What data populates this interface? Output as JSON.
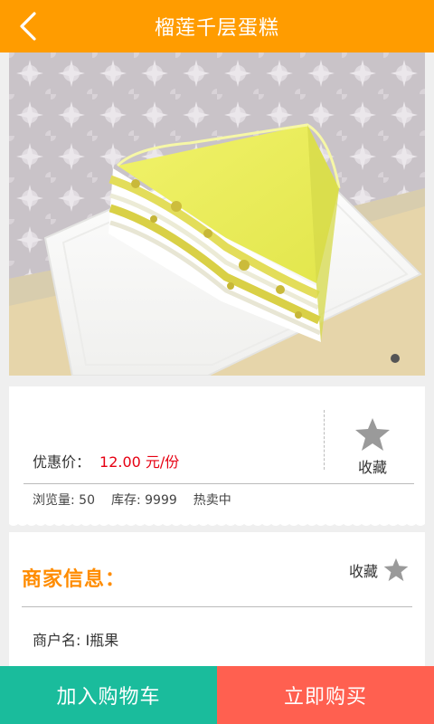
{
  "header": {
    "title": "榴莲千层蛋糕",
    "back_icon": "chevron-left-icon"
  },
  "product": {
    "image_subject": "durian crepe cake slice on white plate",
    "carousel_dots": 1
  },
  "info": {
    "price_label": "优惠价：",
    "price_value": "12.00 元/份",
    "favorite_label": "收藏",
    "views": "浏览量: 50",
    "stock": "库存: 9999",
    "status": "热卖中"
  },
  "merchant": {
    "title": "商家信息：",
    "favorite_label": "收藏",
    "name": "商户名: I瓶果"
  },
  "actions": {
    "add_to_cart": "加入购物车",
    "buy_now": "立即购买"
  },
  "colors": {
    "header": "#ff9c00",
    "accent_orange": "#ff8c00",
    "price_red": "#e60012",
    "cart_button": "#1abc9c",
    "buy_button": "#ff6050"
  }
}
